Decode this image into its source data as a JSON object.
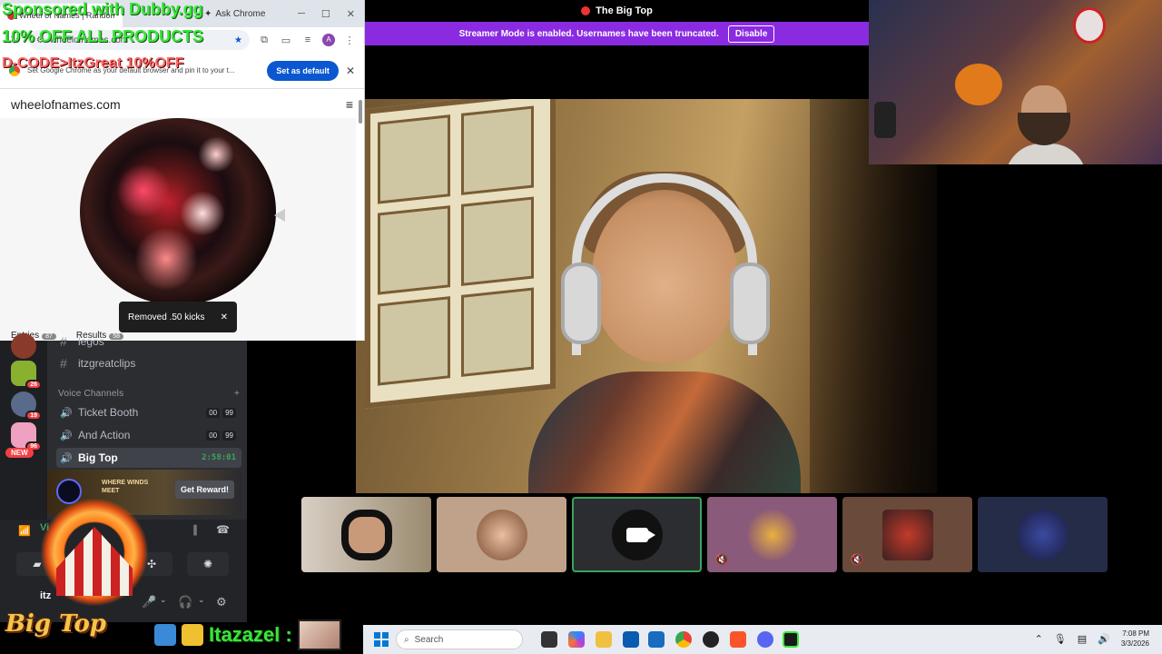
{
  "call": {
    "title": "The Big Top",
    "streamer_notice": "Streamer Mode is enabled. Usernames have been truncated.",
    "disable_label": "Disable"
  },
  "chrome": {
    "tab_title": "Wheel of Names | Random N",
    "ask_chrome": "Ask Chrome",
    "url": "wheelofnames.com",
    "profile_initial": "A",
    "default_prompt": "Set Google Chrome as your default browser and pin it to your t...",
    "set_default_label": "Set as default",
    "site_title": "wheelofnames.com",
    "toast_text": "Removed .50 kicks",
    "entries_label": "Entries",
    "entries_count": "87",
    "results_label": "Results",
    "results_count": "58"
  },
  "overlay": {
    "line1": "Sponsored with Dubby.gg",
    "line2": "10% OFF ALL PRODUCTS",
    "line3": "D-CODE>ItzGreat 10%OFF"
  },
  "discord": {
    "channels": [
      {
        "name": "itzgreatclips"
      }
    ],
    "partial_channel": "legos",
    "voice_header": "Voice Channels",
    "voice_channels": [
      {
        "name": "Ticket Booth",
        "count_a": "00",
        "count_b": "99"
      },
      {
        "name": "And Action",
        "count_a": "00",
        "count_b": "99"
      },
      {
        "name": "Big Top",
        "timer": "2:58:01"
      }
    ],
    "guild_badges": [
      "26",
      "19",
      "96"
    ],
    "new_badge": "NEW",
    "reward_logo": "WHERE WINDS MEET",
    "reward_button": "Get Reward!",
    "voice_status": "Vi",
    "user_name": "itz"
  },
  "branding": {
    "logo_text": "Big Top",
    "subscriber_name": "Itazazel :"
  },
  "taskbar": {
    "search_placeholder": "Search",
    "time": "7:08 PM",
    "date": "3/3/2026"
  },
  "colors": {
    "streamer_purple": "#8a2be2",
    "discord_green": "#3ba55c",
    "ad_green": "#39e639",
    "chrome_blue": "#0b57d0"
  }
}
